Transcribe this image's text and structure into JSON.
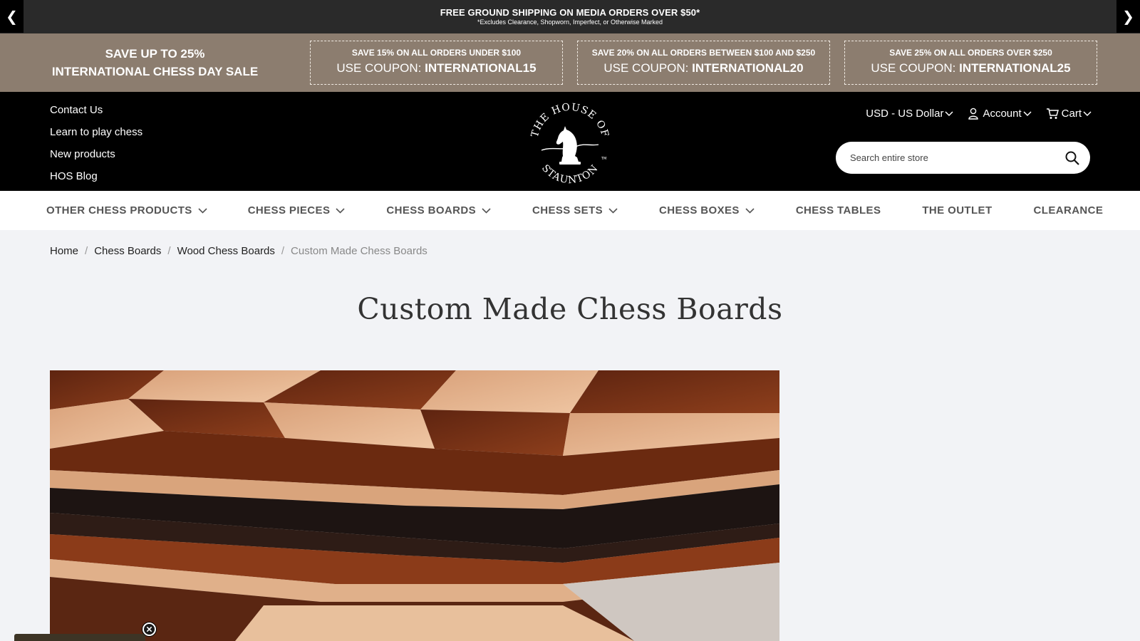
{
  "announcement": {
    "prev_symbol": "❮",
    "next_symbol": "❯",
    "main": "FREE GROUND SHIPPING ON MEDIA ORDERS OVER $50*",
    "sub": "*Excludes Clearance, Shopworn, Imperfect, or Otherwise Marked"
  },
  "promo": {
    "sale_line1": "SAVE UP TO 25%",
    "sale_line2": "INTERNATIONAL CHESS DAY SALE",
    "coupons": [
      {
        "title": "SAVE 15% ON ALL ORDERS UNDER $100",
        "prefix": "USE COUPON: ",
        "code": "INTERNATIONAL15"
      },
      {
        "title": "SAVE 20% ON ALL ORDERS BETWEEN $100 AND $250",
        "prefix": "USE COUPON: ",
        "code": "INTERNATIONAL20"
      },
      {
        "title": "SAVE 25% ON ALL ORDERS OVER $250",
        "prefix": "USE COUPON: ",
        "code": "INTERNATIONAL25"
      }
    ]
  },
  "header": {
    "links": [
      "Contact Us",
      "Learn to play chess",
      "New products",
      "HOS Blog"
    ],
    "logo_text_top": "THE HOUSE OF",
    "logo_text_bottom": "STAUNTON",
    "logo_tm": "TM",
    "currency": "USD - US Dollar",
    "account": "Account",
    "cart": "Cart",
    "search_placeholder": "Search entire store"
  },
  "nav": [
    {
      "label": "OTHER CHESS PRODUCTS",
      "dropdown": true
    },
    {
      "label": "CHESS PIECES",
      "dropdown": true
    },
    {
      "label": "CHESS BOARDS",
      "dropdown": true
    },
    {
      "label": "CHESS SETS",
      "dropdown": true
    },
    {
      "label": "CHESS BOXES",
      "dropdown": true
    },
    {
      "label": "CHESS TABLES",
      "dropdown": false
    },
    {
      "label": "THE OUTLET",
      "dropdown": false
    },
    {
      "label": "CLEARANCE",
      "dropdown": false
    }
  ],
  "breadcrumb": {
    "items": [
      "Home",
      "Chess Boards",
      "Wood Chess Boards"
    ],
    "current": "Custom Made Chess Boards",
    "separator": "/"
  },
  "page_title": "Custom Made Chess Boards",
  "colors": {
    "topbar": "#2a2a2a",
    "promo": "#8c7d6f",
    "header": "#000000",
    "page_bg": "#f2f3f6"
  }
}
